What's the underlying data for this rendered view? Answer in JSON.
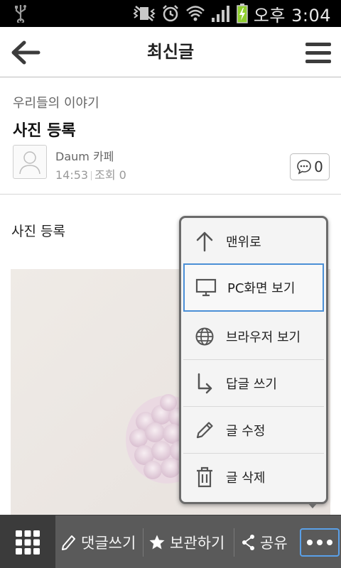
{
  "status_bar": {
    "time": "오후 3:04"
  },
  "app_bar": {
    "title": "최신글"
  },
  "post": {
    "board": "우리들의 이야기",
    "title": "사진 등록",
    "author": "Daum 카페",
    "time": "14:53",
    "views": "조회 0",
    "comment_count": "0",
    "body_text": "사진 등록"
  },
  "popup_menu": {
    "items": [
      {
        "label": "맨위로",
        "icon": "arrow-up-icon"
      },
      {
        "label": "PC화면 보기",
        "icon": "monitor-icon",
        "selected": true
      },
      {
        "label": "브라우저 보기",
        "icon": "globe-icon"
      },
      {
        "label": "답글 쓰기",
        "icon": "reply-arrow-icon"
      },
      {
        "label": "글 수정",
        "icon": "pencil-icon"
      },
      {
        "label": "글 삭제",
        "icon": "trash-icon"
      }
    ]
  },
  "bottom_bar": {
    "comment": "댓글쓰기",
    "bookmark": "보관하기",
    "share": "공유"
  },
  "colors": {
    "status_bar_bg": "#000000",
    "bottom_bar_bg": "#5a5a5a",
    "selection_accent": "#4b8fd6"
  }
}
